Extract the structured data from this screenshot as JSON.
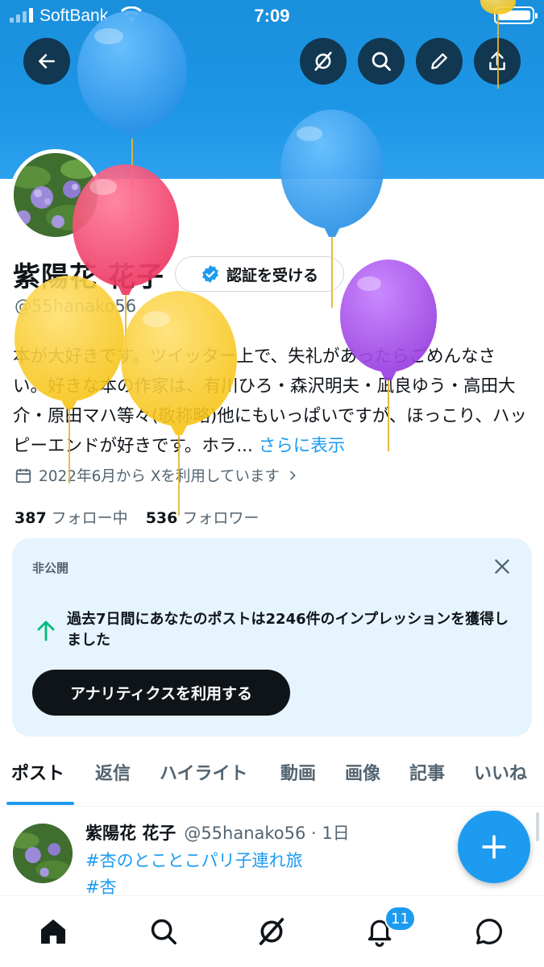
{
  "status_bar": {
    "carrier": "SoftBank",
    "time": "7:09"
  },
  "header": {
    "back_icon": "arrow-left-icon",
    "grok_icon": "grok-icon",
    "search_icon": "search-icon",
    "edit_icon": "pencil-icon",
    "share_icon": "share-icon",
    "banner_color": "#1d96e6"
  },
  "profile": {
    "name": "紫陽花 花子",
    "verify_label": "認証を受ける",
    "handle": "@55hanako56",
    "bio": "本が大好きです。ツイッター上で、失礼があったらごめんなさい。好きな本の作家は、有川ひろ・森沢明夫・凪良ゆう・高田大介・原田マハ等々(敬称略)他にもいっぱいですが、ほっこり、ハッピーエンドが好きです。ホラ...",
    "bio_more": "さらに表示",
    "joined": "2022年6月から Xを利用しています",
    "following_count": "387",
    "following_label": "フォロー中",
    "followers_count": "536",
    "followers_label": "フォロワー"
  },
  "analytics_card": {
    "label": "非公開",
    "text": "過去7日間にあなたのポストは2246件のインプレッションを獲得しました",
    "button": "アナリティクスを利用する",
    "accent": "#00ba7c"
  },
  "tabs": [
    "ポスト",
    "返信",
    "ハイライト",
    "動画",
    "画像",
    "記事",
    "いいね"
  ],
  "post": {
    "name": "紫陽花 花子",
    "meta": "@55hanako56 · 1日",
    "tags": [
      "#杏のとことこパリ子連れ旅",
      "#杏"
    ]
  },
  "bottom_nav": {
    "items": [
      "home-icon",
      "search-icon",
      "grok-icon",
      "bell-icon",
      "messages-icon"
    ],
    "notification_badge": "11"
  },
  "colors": {
    "accent": "#1d9bf0",
    "text": "#0f1419",
    "muted": "#536471"
  }
}
